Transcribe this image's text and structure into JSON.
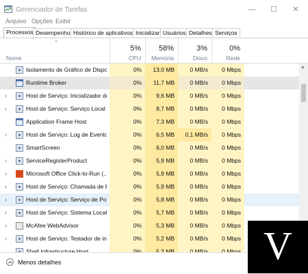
{
  "window": {
    "title": "Gerenciador de Tarefas",
    "controls": {
      "minimize": "—",
      "maximize": "☐",
      "close": "✕"
    }
  },
  "menu": [
    {
      "label": "Arquivo"
    },
    {
      "label": "Opções"
    },
    {
      "label": "Exibir"
    }
  ],
  "tabs": [
    {
      "label": "Processos",
      "active": true
    },
    {
      "label": "Desempenho"
    },
    {
      "label": "Histórico de aplicativos"
    },
    {
      "label": "Inicializar"
    },
    {
      "label": "Usuários"
    },
    {
      "label": "Detalhes"
    },
    {
      "label": "Serviços"
    }
  ],
  "columns": {
    "name": {
      "label": "Nome",
      "sort_caret": "^"
    },
    "cpu": {
      "percent": "5%",
      "label": "CPU"
    },
    "memory": {
      "percent": "58%",
      "label": "Memória"
    },
    "disk": {
      "percent": "3%",
      "label": "Disco"
    },
    "network": {
      "percent": "0%",
      "label": "Rede"
    }
  },
  "rows": [
    {
      "name": "Isolamento de Gráfico de Dispo...",
      "icon": "service-icon",
      "expand": "",
      "cpu": "0%",
      "memory": "13,0 MB",
      "disk": "0 MB/s",
      "network": "0 Mbps"
    },
    {
      "name": "Runtime Broker",
      "icon": "app-window-icon",
      "expand": "",
      "cpu": "0%",
      "memory": "11,7 MB",
      "disk": "0 MB/s",
      "network": "0 Mbps",
      "state": "selected"
    },
    {
      "name": "Host de Serviço: Inicializador de...",
      "icon": "service-icon",
      "expand": "›",
      "cpu": "0%",
      "memory": "9,6 MB",
      "disk": "0 MB/s",
      "network": "0 Mbps"
    },
    {
      "name": "Host de Serviço: Serviço Local (...",
      "icon": "service-icon",
      "expand": "›",
      "cpu": "0%",
      "memory": "8,7 MB",
      "disk": "0 MB/s",
      "network": "0 Mbps"
    },
    {
      "name": "Application Frame Host",
      "icon": "app-window-icon",
      "expand": "",
      "cpu": "0%",
      "memory": "7,3 MB",
      "disk": "0 MB/s",
      "network": "0 Mbps"
    },
    {
      "name": "Host de Serviço: Log de Eventos...",
      "icon": "service-icon",
      "expand": "›",
      "cpu": "0%",
      "memory": "6,5 MB",
      "disk": "0,1 MB/s",
      "network": "0 Mbps",
      "disk_highlight": true
    },
    {
      "name": "SmartScreen",
      "icon": "service-icon",
      "expand": "",
      "cpu": "0%",
      "memory": "6,0 MB",
      "disk": "0 MB/s",
      "network": "0 Mbps"
    },
    {
      "name": "ServiceRegisterProduct",
      "icon": "service-icon",
      "expand": "›",
      "cpu": "0%",
      "memory": "5,9 MB",
      "disk": "0 MB/s",
      "network": "0 Mbps"
    },
    {
      "name": "Microsoft Office Click-to-Run (...",
      "icon": "office-icon",
      "expand": "›",
      "cpu": "0%",
      "memory": "5,9 MB",
      "disk": "0 MB/s",
      "network": "0 Mbps"
    },
    {
      "name": "Host de Serviço: Chamada de P...",
      "icon": "service-icon",
      "expand": "›",
      "cpu": "0%",
      "memory": "5,9 MB",
      "disk": "0 MB/s",
      "network": "0 Mbps"
    },
    {
      "name": "Host de Serviço: Serviço de Polí...",
      "icon": "service-icon",
      "expand": "›",
      "cpu": "0%",
      "memory": "5,8 MB",
      "disk": "0 MB/s",
      "network": "0 Mbps",
      "state": "hover"
    },
    {
      "name": "Host de Serviço: Sistema Local",
      "icon": "service-icon",
      "expand": "›",
      "cpu": "0%",
      "memory": "5,7 MB",
      "disk": "0 MB/s",
      "network": "0 Mbps"
    },
    {
      "name": "McAfee WebAdvisor",
      "icon": "mcafee-icon",
      "expand": "›",
      "cpu": "0%",
      "memory": "5,3 MB",
      "disk": "0 MB/s",
      "network": "0 Mbps"
    },
    {
      "name": "Host de Serviço: Testador de ins...",
      "icon": "service-icon",
      "expand": "›",
      "cpu": "0%",
      "memory": "5,2 MB",
      "disk": "0 MB/s",
      "network": "0 Mbps"
    },
    {
      "name": "Shell Infrastructure Host",
      "icon": "service-icon",
      "expand": "",
      "cpu": "0%",
      "memory": "5,2 MB",
      "disk": "0 MB/s",
      "network": "0 Mbps"
    }
  ],
  "scrollbar": {
    "up": "▲",
    "down": "▼"
  },
  "footer": {
    "fewer_details": "Menos detalhes"
  },
  "watermark": {
    "letter": "V"
  }
}
